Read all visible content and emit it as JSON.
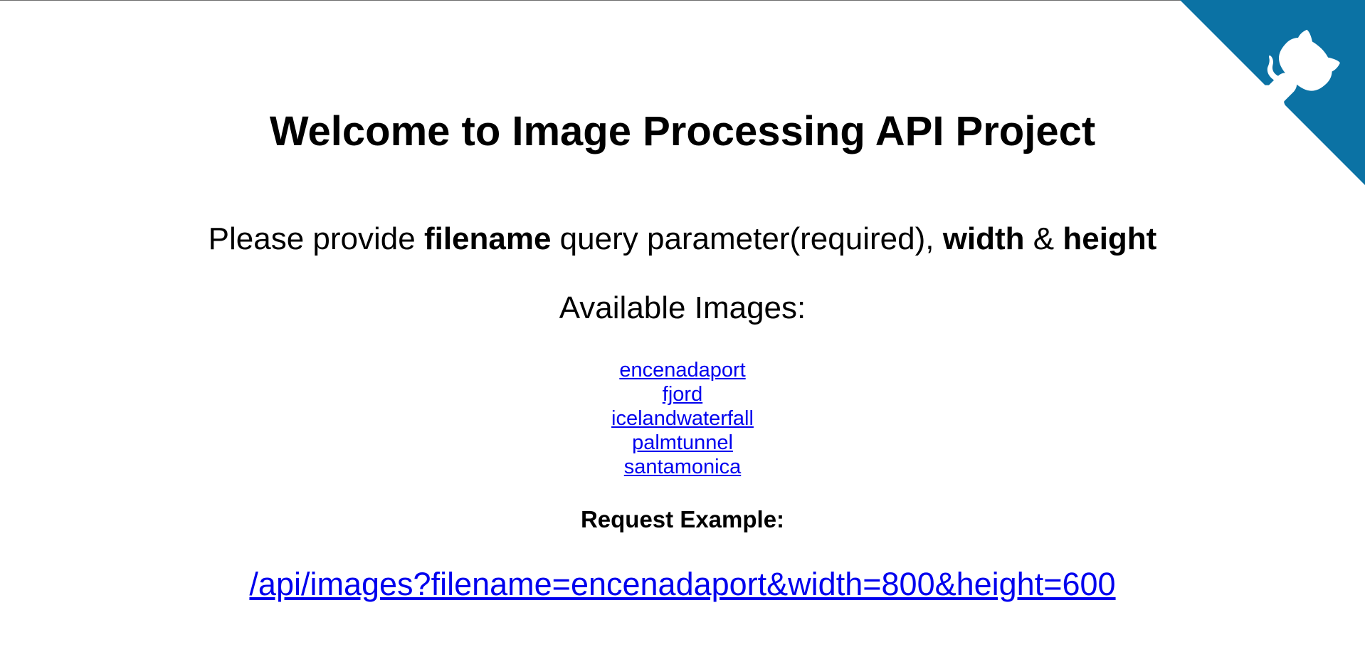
{
  "header": {
    "title": "Welcome to Image Processing API Project"
  },
  "instructions": {
    "prefix": "Please provide ",
    "param_filename": "filename",
    "middle": " query parameter(required), ",
    "param_width": "width",
    "amp": " & ",
    "param_height": "height"
  },
  "available": {
    "heading": "Available Images:",
    "images": [
      "encenadaport",
      "fjord",
      "icelandwaterfall",
      "palmtunnel",
      "santamonica"
    ]
  },
  "example": {
    "heading": "Request Example:",
    "link": "/api/images?filename=encenadaport&width=800&height=600"
  },
  "corner": {
    "icon": "github-octocat-icon",
    "color": "#0b72a4"
  }
}
